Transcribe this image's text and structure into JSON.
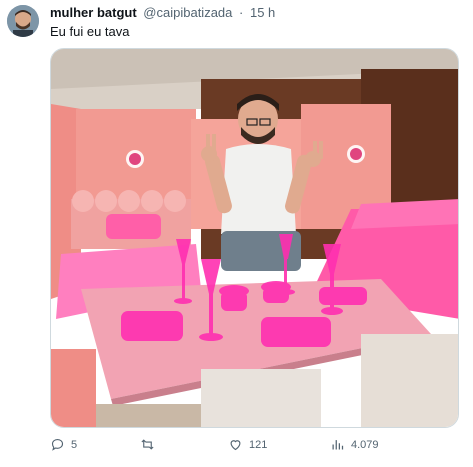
{
  "tweet": {
    "author_name": "mulher batgut",
    "handle": "@caipibatizada",
    "separator": "·",
    "time": "15 h",
    "text": "Eu fui eu tava"
  },
  "actions": {
    "replies": "5",
    "retweets": "",
    "likes": "121",
    "views": "4.079"
  },
  "colors": {
    "accent_pink": "#ff4fbf",
    "wall_pink": "#f29a92",
    "text_secondary": "#536471"
  },
  "icons": [
    "reply-icon",
    "retweet-icon",
    "like-icon",
    "views-icon"
  ]
}
